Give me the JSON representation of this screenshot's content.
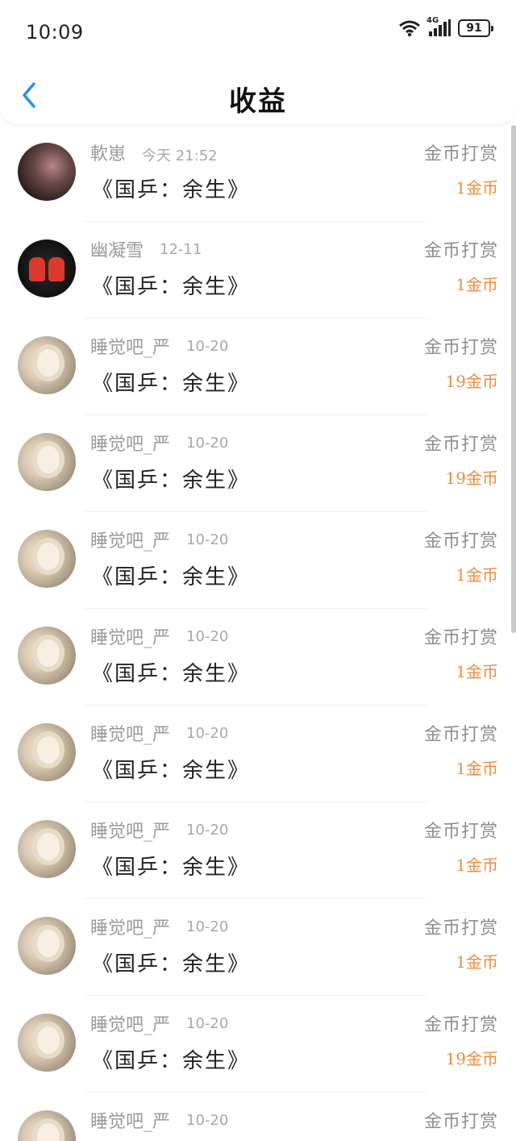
{
  "status_bar": {
    "time": "10:09",
    "network": "4G",
    "battery": "91"
  },
  "header": {
    "title": "收益",
    "back_icon": "chevron-left-icon"
  },
  "accent_colors": {
    "back": "#2d8cf0",
    "amount": "#f08a3c"
  },
  "entries": [
    {
      "username": "軟崽",
      "date": "今天 21:52",
      "work": "《国乒：余生》",
      "type": "金币打赏",
      "amount": "1金币",
      "avatar": "dark"
    },
    {
      "username": "幽凝雪",
      "date": "12-11",
      "work": "《国乒：余生》",
      "type": "金币打赏",
      "amount": "1金币",
      "avatar": "couple"
    },
    {
      "username": "睡觉吧_严",
      "date": "10-20",
      "work": "《国乒：余生》",
      "type": "金币打赏",
      "amount": "19金币",
      "avatar": "girl"
    },
    {
      "username": "睡觉吧_严",
      "date": "10-20",
      "work": "《国乒：余生》",
      "type": "金币打赏",
      "amount": "19金币",
      "avatar": "girl"
    },
    {
      "username": "睡觉吧_严",
      "date": "10-20",
      "work": "《国乒：余生》",
      "type": "金币打赏",
      "amount": "1金币",
      "avatar": "girl"
    },
    {
      "username": "睡觉吧_严",
      "date": "10-20",
      "work": "《国乒：余生》",
      "type": "金币打赏",
      "amount": "1金币",
      "avatar": "girl"
    },
    {
      "username": "睡觉吧_严",
      "date": "10-20",
      "work": "《国乒：余生》",
      "type": "金币打赏",
      "amount": "1金币",
      "avatar": "girl"
    },
    {
      "username": "睡觉吧_严",
      "date": "10-20",
      "work": "《国乒：余生》",
      "type": "金币打赏",
      "amount": "1金币",
      "avatar": "girl"
    },
    {
      "username": "睡觉吧_严",
      "date": "10-20",
      "work": "《国乒：余生》",
      "type": "金币打赏",
      "amount": "1金币",
      "avatar": "girl"
    },
    {
      "username": "睡觉吧_严",
      "date": "10-20",
      "work": "《国乒：余生》",
      "type": "金币打赏",
      "amount": "19金币",
      "avatar": "girl"
    },
    {
      "username": "睡觉吧_严",
      "date": "10-20",
      "work": "",
      "type": "金币打赏",
      "amount": "",
      "avatar": "girl"
    }
  ]
}
